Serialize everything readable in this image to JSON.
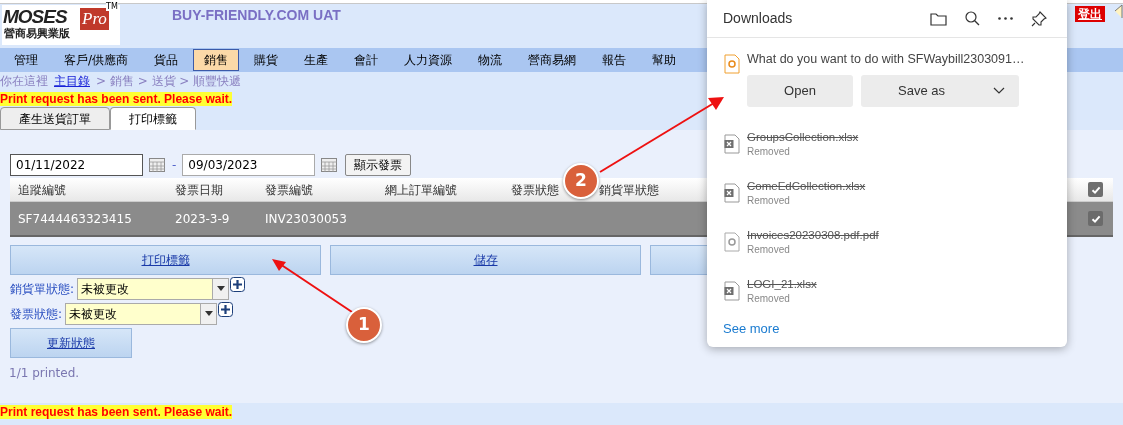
{
  "header": {
    "logo": {
      "word": "MOSES",
      "pro": "Pro",
      "tm": "TM",
      "subtitle": "營商易興業版"
    },
    "site_title": "BUY-FRIENDLY.COM UAT",
    "logout": "登出"
  },
  "menu": [
    {
      "label": "管理",
      "selected": false
    },
    {
      "label": "客戶/供應商",
      "selected": false
    },
    {
      "label": "貨品",
      "selected": false
    },
    {
      "label": "銷售",
      "selected": true
    },
    {
      "label": "購貨",
      "selected": false
    },
    {
      "label": "生產",
      "selected": false
    },
    {
      "label": "會計",
      "selected": false
    },
    {
      "label": "人力資源",
      "selected": false
    },
    {
      "label": "物流",
      "selected": false
    },
    {
      "label": "營商易網",
      "selected": false
    },
    {
      "label": "報告",
      "selected": false
    },
    {
      "label": "幫助",
      "selected": false
    }
  ],
  "breadcrumb": {
    "prefix": "你在這裡",
    "home": "主目錄",
    "path": "> 銷售 > 送貨 > 順豐快遞"
  },
  "message_top": "Print request has been sent. Please wait.",
  "tabs": [
    {
      "label": "產生送貨訂單",
      "selected": false
    },
    {
      "label": "打印標籤",
      "selected": true
    }
  ],
  "date_from": "01/11/2022",
  "date_sep": "-",
  "date_to": "09/03/2023",
  "show_button": "顯示發票",
  "table": {
    "columns": [
      "追蹤編號",
      "發票日期",
      "發票編號",
      "網上訂單編號",
      "發票狀態",
      "銷貨單狀態"
    ],
    "header_checked": true,
    "rows": [
      {
        "cells": [
          "SF7444463323415",
          "2023-3-9",
          "INV23030053",
          "",
          "",
          ""
        ],
        "checked": true
      }
    ]
  },
  "action_buttons": [
    {
      "kind": "text",
      "label": "打印標籤"
    },
    {
      "kind": "text",
      "label": "儲存"
    },
    {
      "kind": "covered"
    }
  ],
  "status_fields": [
    {
      "label": "銷貨單狀態:",
      "value": "未被更改"
    },
    {
      "label": "發票狀態:",
      "value": "未被更改"
    }
  ],
  "update_button": "更新狀態",
  "printed_note": "1/1 printed.",
  "message_bottom": "Print request has been sent. Please wait.",
  "downloads": {
    "title": "Downloads",
    "prompt": "What do you want to do with SFWaybill2303091…",
    "open": "Open",
    "save_as": "Save as",
    "items": [
      {
        "kind": "xlsx",
        "name": "GroupsCollection.xlsx",
        "status": "Removed"
      },
      {
        "kind": "xlsx",
        "name": "ComeEdCollection.xlsx",
        "status": "Removed"
      },
      {
        "kind": "pdf",
        "name": "Invoices20230308.pdf.pdf",
        "status": "Removed"
      },
      {
        "kind": "xlsx",
        "name": "LOGI_21.xlsx",
        "status": "Removed"
      }
    ],
    "see_more": "See more"
  },
  "annotations": [
    "1",
    "2"
  ]
}
